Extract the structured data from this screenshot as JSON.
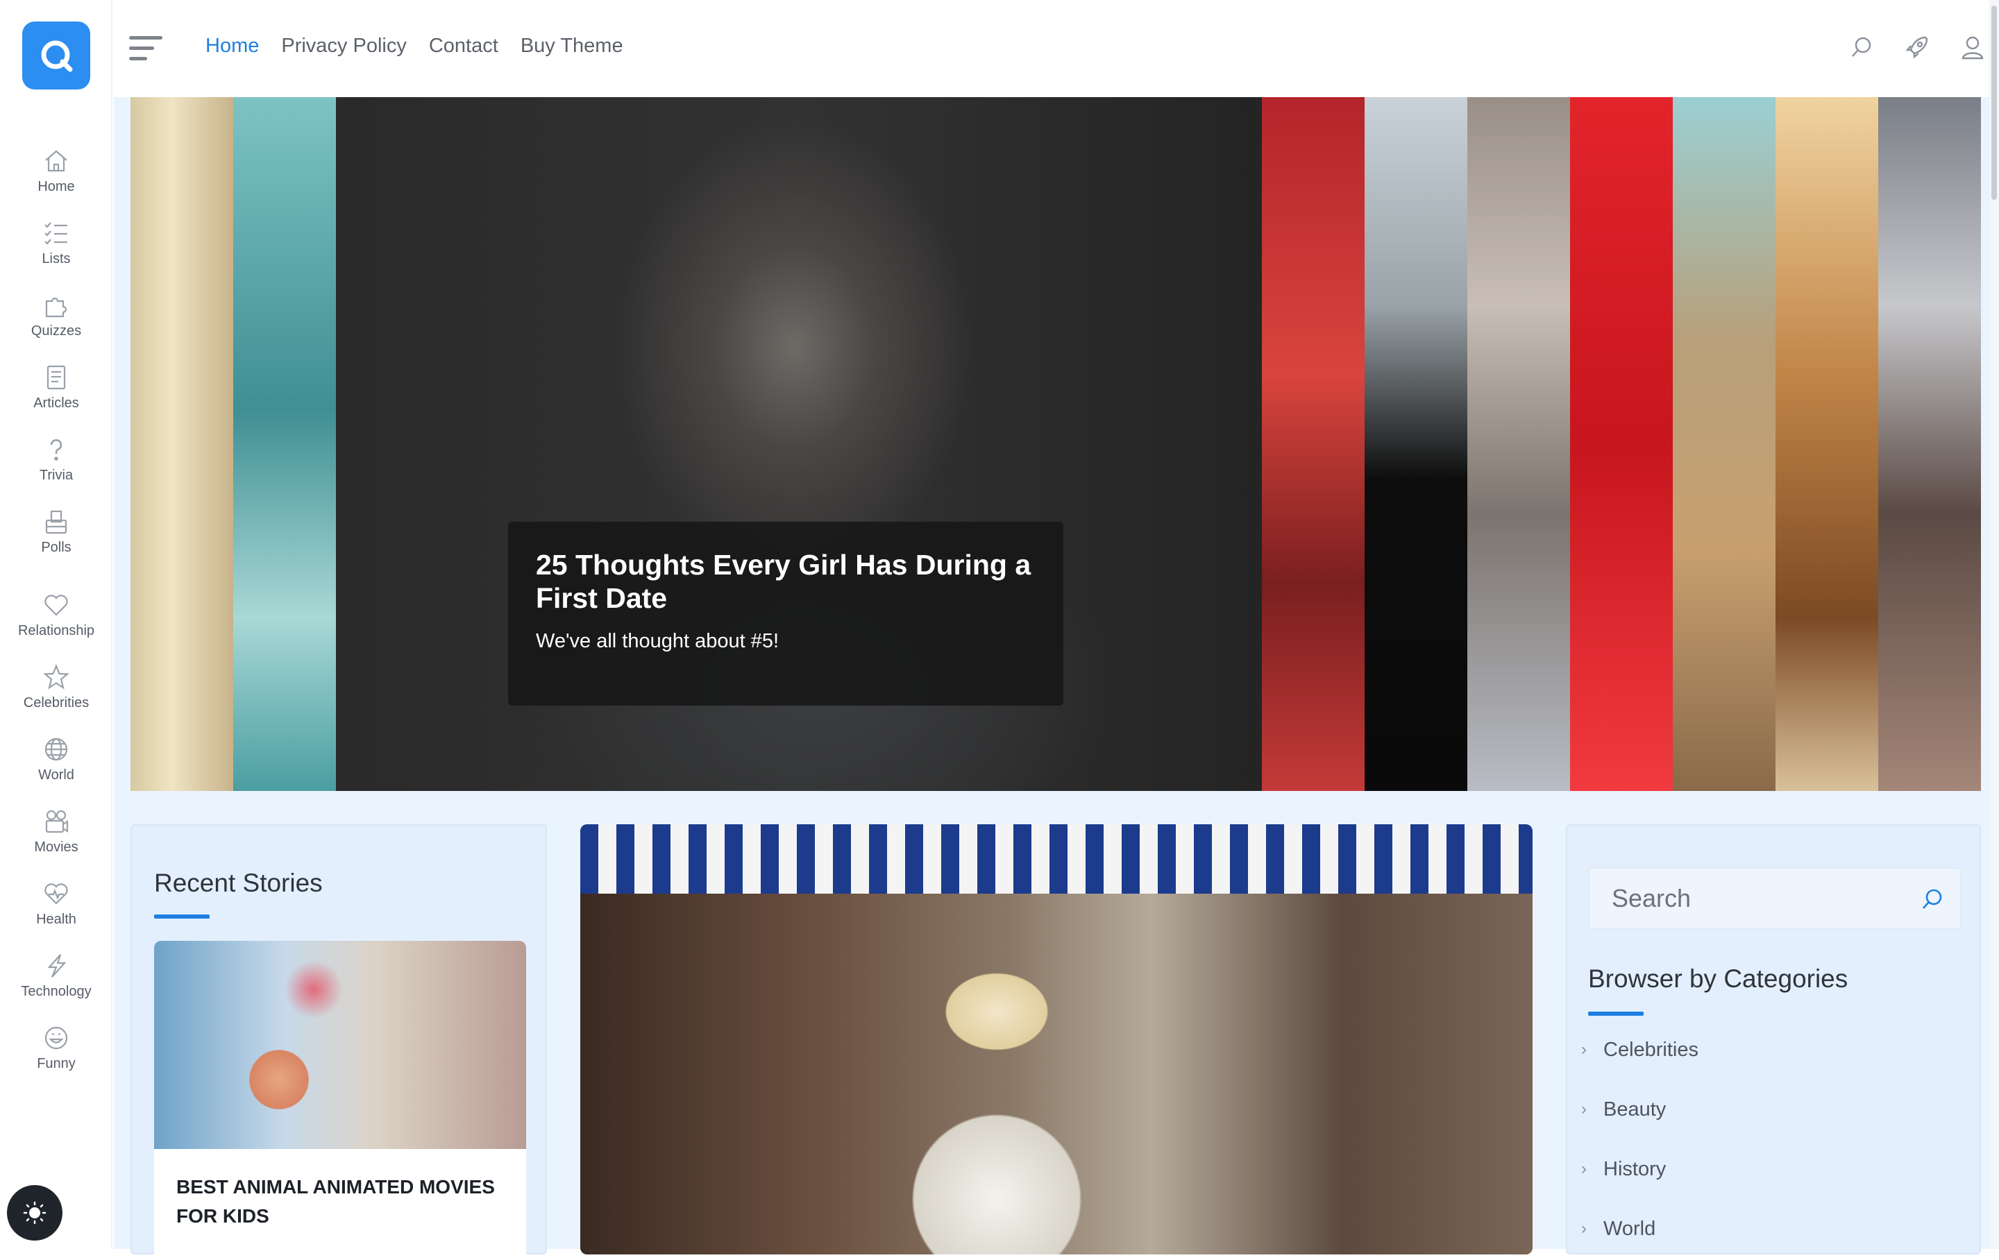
{
  "logo": {
    "icon": "q-logo-icon",
    "color": "#2b8ef0"
  },
  "sidebar": {
    "items": [
      {
        "label": "Home",
        "icon": "home-icon"
      },
      {
        "label": "Lists",
        "icon": "list-icon"
      },
      {
        "label": "Quizzes",
        "icon": "puzzle-icon"
      },
      {
        "label": "Articles",
        "icon": "article-icon"
      },
      {
        "label": "Trivia",
        "icon": "question-icon"
      },
      {
        "label": "Polls",
        "icon": "poll-icon"
      },
      {
        "label": "Relationship",
        "icon": "heart-icon"
      },
      {
        "label": "Celebrities",
        "icon": "star-icon"
      },
      {
        "label": "World",
        "icon": "globe-icon"
      },
      {
        "label": "Movies",
        "icon": "film-icon"
      },
      {
        "label": "Health",
        "icon": "health-icon"
      },
      {
        "label": "Technology",
        "icon": "lightning-icon"
      },
      {
        "label": "Funny",
        "icon": "smile-icon"
      }
    ],
    "theme_toggle_icon": "sun-icon"
  },
  "header": {
    "menu_icon": "hamburger-icon",
    "nav": [
      "Home",
      "Privacy Policy",
      "Contact",
      "Buy Theme"
    ],
    "active": "Home",
    "icons": [
      "search-icon",
      "rocket-icon",
      "user-icon"
    ],
    "accent_color": "#1f7fe0"
  },
  "hero": {
    "title": "25 Thoughts Every Girl Has During a First Date",
    "subtitle": "We've all thought about #5!"
  },
  "recent": {
    "title": "Recent Stories",
    "story_title": "BEST ANIMAL ANIMATED MOVIES FOR KIDS"
  },
  "sidebar_right": {
    "search_placeholder": "Search",
    "categories_title": "Browser by Categories",
    "categories": [
      "Celebrities",
      "Beauty",
      "History",
      "World"
    ]
  }
}
